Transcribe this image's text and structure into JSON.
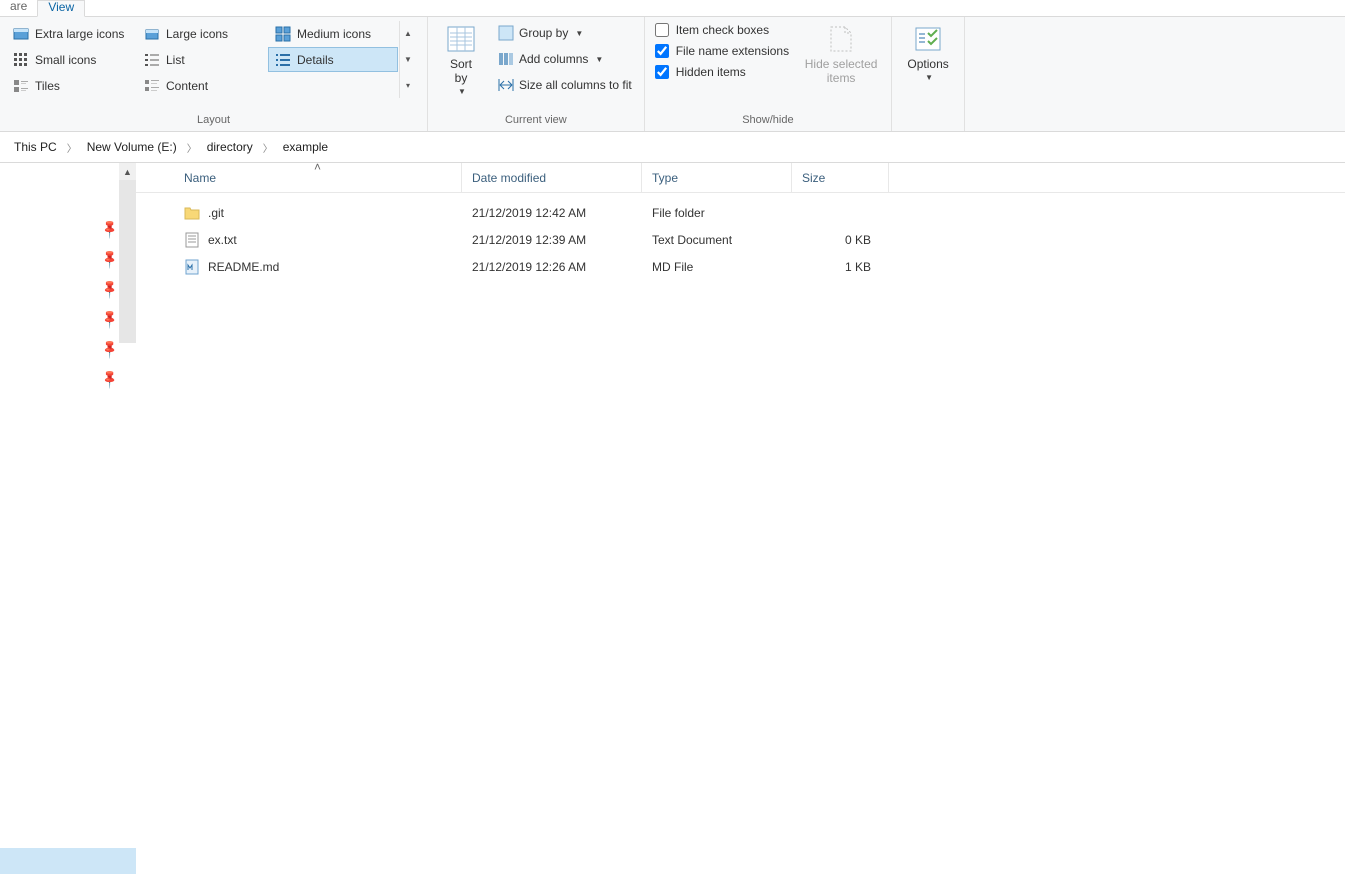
{
  "tabs": {
    "share": "are",
    "view": "View"
  },
  "ribbon": {
    "layout": {
      "label": "Layout",
      "items": {
        "xl": "Extra large icons",
        "lg": "Large icons",
        "md": "Medium icons",
        "sm": "Small icons",
        "list": "List",
        "details": "Details",
        "tiles": "Tiles",
        "content": "Content"
      }
    },
    "current_view": {
      "label": "Current view",
      "sort_by": "Sort\nby",
      "group_by": "Group by",
      "add_columns": "Add columns",
      "size_all": "Size all columns to fit"
    },
    "show_hide": {
      "label": "Show/hide",
      "item_checkboxes": "Item check boxes",
      "file_ext": "File name extensions",
      "hidden_items": "Hidden items",
      "hide_selected": "Hide selected\nitems"
    },
    "options": {
      "label": "Options"
    }
  },
  "breadcrumb": [
    "This PC",
    "New Volume (E:)",
    "directory",
    "example"
  ],
  "columns": {
    "name": "Name",
    "date": "Date modified",
    "type": "Type",
    "size": "Size"
  },
  "files": [
    {
      "icon": "folder",
      "name": ".git",
      "date": "21/12/2019 12:42 AM",
      "type": "File folder",
      "size": ""
    },
    {
      "icon": "text",
      "name": "ex.txt",
      "date": "21/12/2019 12:39 AM",
      "type": "Text Document",
      "size": "0 KB"
    },
    {
      "icon": "md",
      "name": "README.md",
      "date": "21/12/2019 12:26 AM",
      "type": "MD File",
      "size": "1 KB"
    }
  ]
}
